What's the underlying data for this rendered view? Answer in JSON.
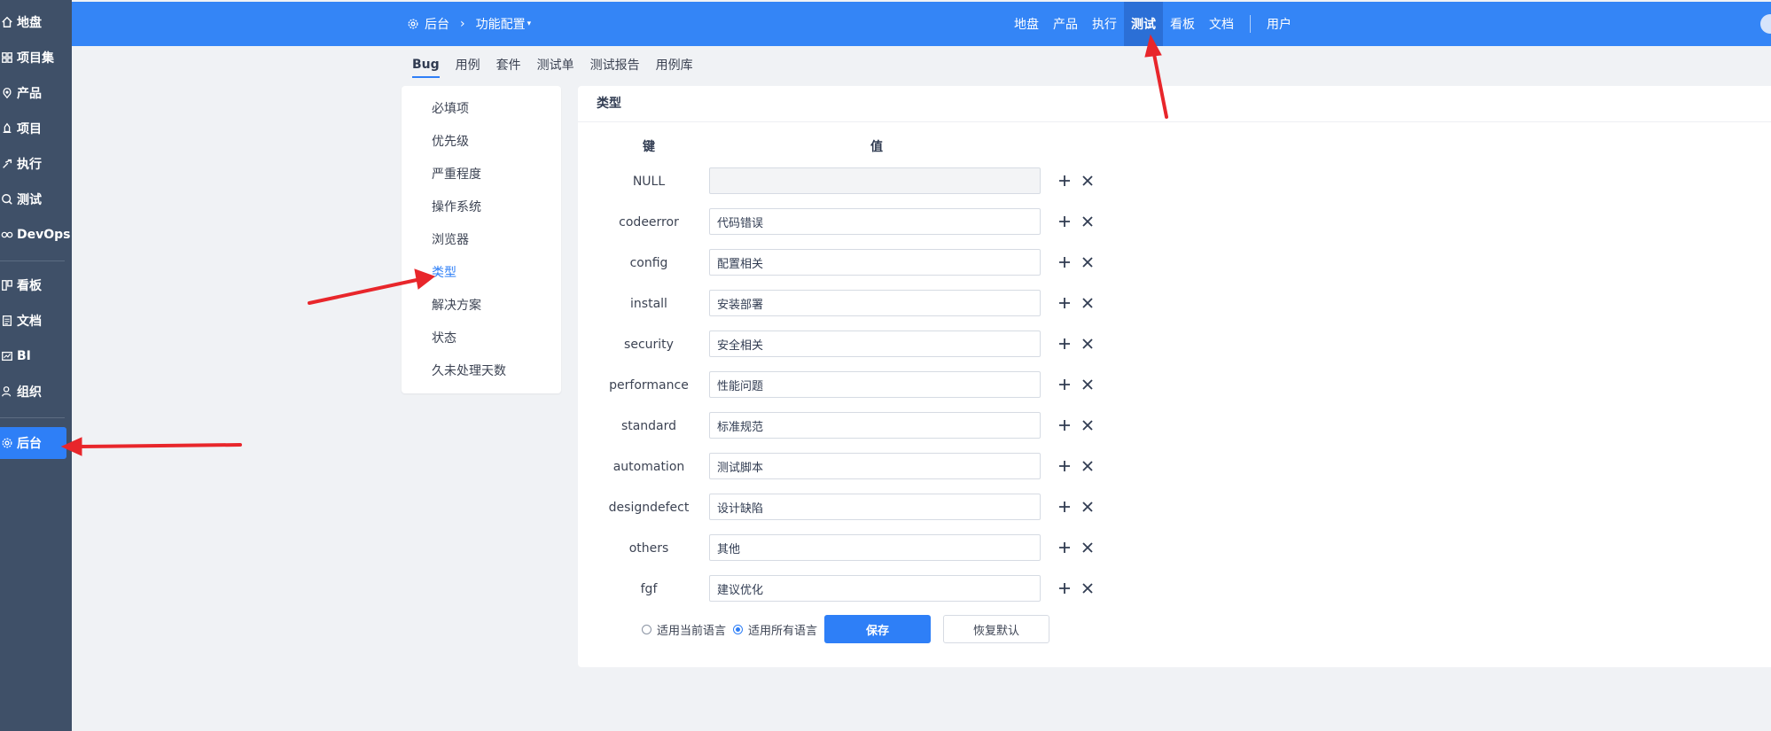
{
  "sidebar": {
    "items": [
      {
        "label": "地盘",
        "icon": "home-icon"
      },
      {
        "label": "项目集",
        "icon": "grid-icon"
      },
      {
        "label": "产品",
        "icon": "product-icon"
      },
      {
        "label": "项目",
        "icon": "project-icon"
      },
      {
        "label": "执行",
        "icon": "execute-icon"
      },
      {
        "label": "测试",
        "icon": "test-icon"
      },
      {
        "label": "DevOps",
        "icon": "devops-icon"
      },
      {
        "label": "看板",
        "icon": "kanban-icon"
      },
      {
        "label": "文档",
        "icon": "doc-icon"
      },
      {
        "label": "BI",
        "icon": "bi-icon"
      },
      {
        "label": "组织",
        "icon": "org-icon"
      },
      {
        "label": "后台",
        "icon": "gear-icon"
      }
    ],
    "active": "后台"
  },
  "header": {
    "breadcrumb_root": "后台",
    "breadcrumb_current": "功能配置",
    "nav": [
      "地盘",
      "产品",
      "执行",
      "测试",
      "看板",
      "文档"
    ],
    "nav_active": "测试",
    "user": "用户"
  },
  "subtabs": {
    "items": [
      "Bug",
      "用例",
      "套件",
      "测试单",
      "测试报告",
      "用例库"
    ],
    "active": "Bug"
  },
  "menu": {
    "items": [
      "必填项",
      "优先级",
      "严重程度",
      "操作系统",
      "浏览器",
      "类型",
      "解决方案",
      "状态",
      "久未处理天数"
    ],
    "active": "类型"
  },
  "content": {
    "title": "类型",
    "key_header": "键",
    "value_header": "值",
    "rows": [
      {
        "key": "NULL",
        "value": ""
      },
      {
        "key": "codeerror",
        "value": "代码错误"
      },
      {
        "key": "config",
        "value": "配置相关"
      },
      {
        "key": "install",
        "value": "安装部署"
      },
      {
        "key": "security",
        "value": "安全相关"
      },
      {
        "key": "performance",
        "value": "性能问题"
      },
      {
        "key": "standard",
        "value": "标准规范"
      },
      {
        "key": "automation",
        "value": "测试脚本"
      },
      {
        "key": "designdefect",
        "value": "设计缺陷"
      },
      {
        "key": "others",
        "value": "其他"
      },
      {
        "key": "fgf",
        "value": "建议优化"
      }
    ],
    "radio_current": "适用当前语言",
    "radio_all": "适用所有语言",
    "radio_selected": "all",
    "save_label": "保存",
    "reset_label": "恢复默认"
  },
  "colors": {
    "sidebar_bg": "#3f5068",
    "header_bg": "#3485f6",
    "accent": "#2e7ff7",
    "annotation_arrow": "#e8262b"
  }
}
